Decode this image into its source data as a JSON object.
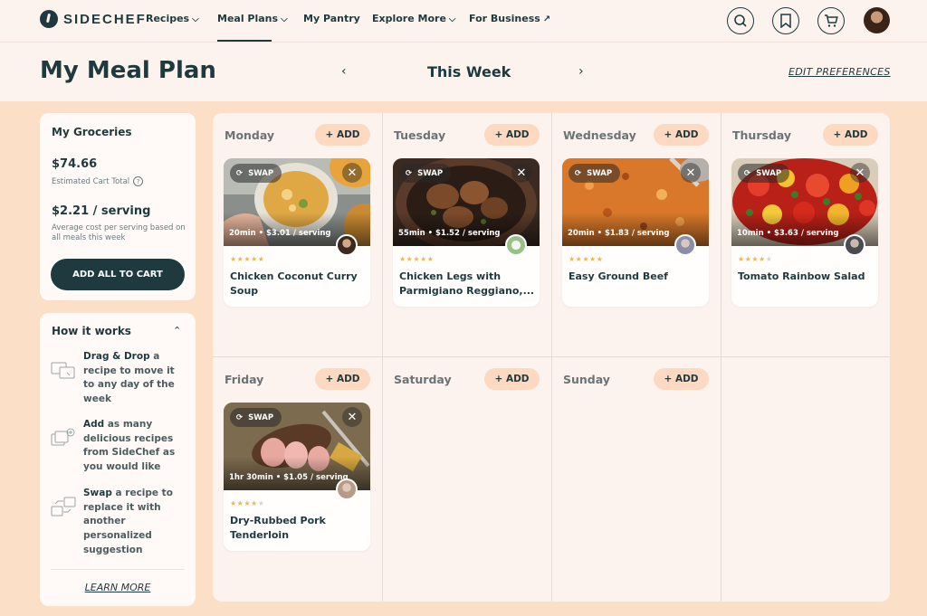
{
  "nav": {
    "logo": "SIDECHEF",
    "items": [
      {
        "label": "Recipes",
        "chevron": true
      },
      {
        "label": "Meal Plans",
        "chevron": true,
        "active": true
      },
      {
        "label": "My Pantry",
        "chevron": false
      },
      {
        "label": "Explore More",
        "chevron": true
      },
      {
        "label": "For Business",
        "arrow": "↗"
      }
    ],
    "icons": [
      "search-icon",
      "bookmark-icon",
      "cart-icon",
      "user-avatar"
    ]
  },
  "header": {
    "title": "My Meal Plan",
    "week_label": "This Week",
    "prev": "‹",
    "next": "›",
    "edit_preferences": "EDIT PREFERENCES"
  },
  "groceries": {
    "title": "My Groceries",
    "total": "$74.66",
    "total_label": "Estimated Cart Total",
    "help": "?",
    "per_serving": "$2.21 / serving",
    "per_serving_desc": "Average cost per serving based on all meals this week",
    "cta": "ADD ALL TO CART"
  },
  "how_it_works": {
    "title": "How it works",
    "steps": [
      {
        "bold": "Drag & Drop",
        "text": " a recipe to move it to any day of the week"
      },
      {
        "bold": "Add",
        "text": " as many delicious recipes from SideChef as you would like"
      },
      {
        "bold": "Swap",
        "text": " a recipe to replace it with another personalized suggestion"
      }
    ],
    "learn_more": "LEARN MORE"
  },
  "days": [
    {
      "name": "Monday",
      "add": "+ ADD",
      "recipe": {
        "swap": "SWAP",
        "meta": "20min • $3.01 / serving",
        "stars": 4.5,
        "title": "Chicken Coconut Curry Soup"
      }
    },
    {
      "name": "Tuesday",
      "add": "+ ADD",
      "recipe": {
        "swap": "SWAP",
        "meta": "55min • $1.52 / serving",
        "stars": 4.5,
        "title": "Chicken Legs with Parmigiano Reggiano,..."
      }
    },
    {
      "name": "Wednesday",
      "add": "+ ADD",
      "recipe": {
        "swap": "SWAP",
        "meta": "20min • $1.83 / serving",
        "stars": 4.5,
        "title": "Easy Ground Beef"
      }
    },
    {
      "name": "Thursday",
      "add": "+ ADD",
      "recipe": {
        "swap": "SWAP",
        "meta": "10min • $3.63 / serving",
        "stars": 4,
        "title": "Tomato Rainbow Salad"
      }
    },
    {
      "name": "Friday",
      "add": "+ ADD",
      "recipe": {
        "swap": "SWAP",
        "meta": "1hr 30min • $1.05 / serving",
        "stars": 4,
        "title": "Dry-Rubbed Pork Tenderloin"
      }
    },
    {
      "name": "Saturday",
      "add": "+ ADD"
    },
    {
      "name": "Sunday",
      "add": "+ ADD"
    }
  ],
  "colors": {
    "brand_dark": "#1e3a3f",
    "page_bg": "#fcdfc7",
    "add_pill": "#fcd9c0",
    "star": "#f0b64a"
  }
}
